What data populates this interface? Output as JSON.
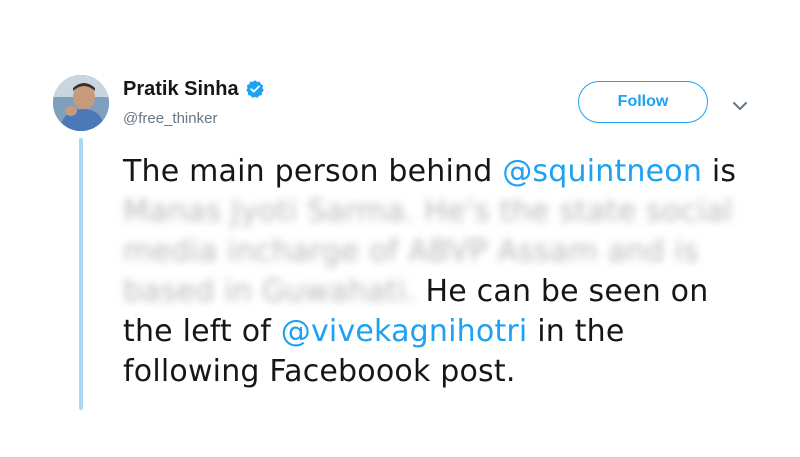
{
  "author": {
    "display_name": "Pratik Sinha",
    "handle": "@free_thinker",
    "verified": true
  },
  "follow_label": "Follow",
  "tweet": {
    "part1": "The main person behind ",
    "mention1": "@squintneon",
    "part2": " is ",
    "blurred_text": "Manas Jyoti Sarma. He's the state social media incharge of ABVP Assam and is based in Guwahati.",
    "part3": " He can be seen on the left of ",
    "mention2": "@vivekagnihotri",
    "part4": " in the following Faceboook post."
  },
  "colors": {
    "accent": "#1da1f2",
    "thread_line": "#a8d8f5",
    "text": "#14171a",
    "secondary": "#657786"
  },
  "icons": {
    "verified": "verified-badge-icon",
    "caret": "chevron-down-icon"
  }
}
